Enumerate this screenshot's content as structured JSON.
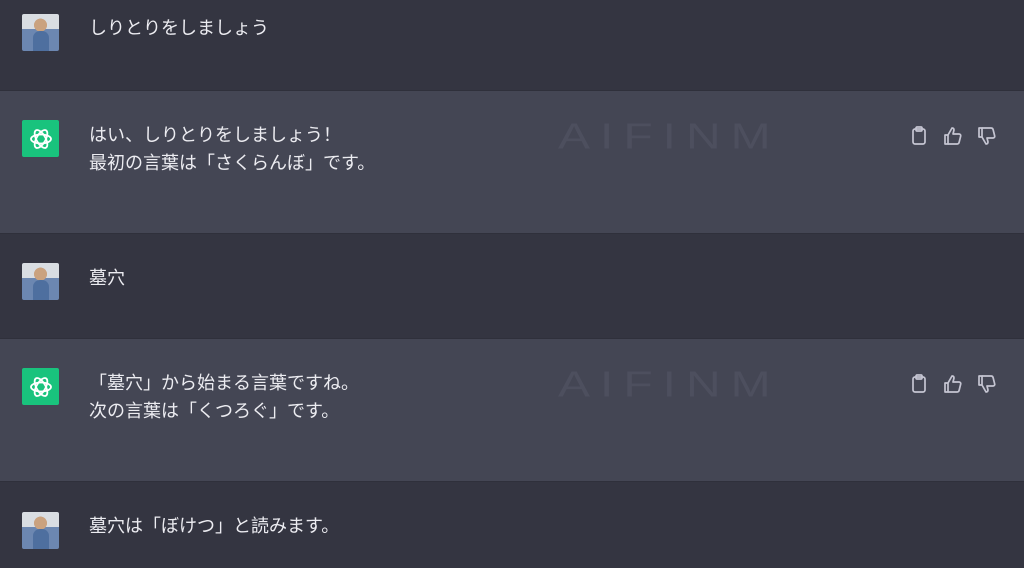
{
  "messages": [
    {
      "role": "user",
      "lines": [
        "しりとりをしましょう"
      ]
    },
    {
      "role": "assistant",
      "lines": [
        "はい、しりとりをしましょう！",
        "最初の言葉は「さくらんぼ」です。"
      ],
      "watermark": "AIFINM"
    },
    {
      "role": "user",
      "lines": [
        "墓穴"
      ]
    },
    {
      "role": "assistant",
      "lines": [
        "「墓穴」から始まる言葉ですね。",
        "次の言葉は「くつろぐ」です。"
      ],
      "watermark": "AIFINM"
    },
    {
      "role": "user",
      "lines": [
        "墓穴は「ぼけつ」と読みます。"
      ]
    }
  ],
  "icons": {
    "assistant_avatar": "openai-logo-icon",
    "copy": "clipboard-icon",
    "like": "thumbs-up-icon",
    "dislike": "thumbs-down-icon"
  },
  "colors": {
    "user_bg": "#343541",
    "assistant_bg": "#444654",
    "assistant_avatar": "#19c37d",
    "text": "#ececf1"
  }
}
